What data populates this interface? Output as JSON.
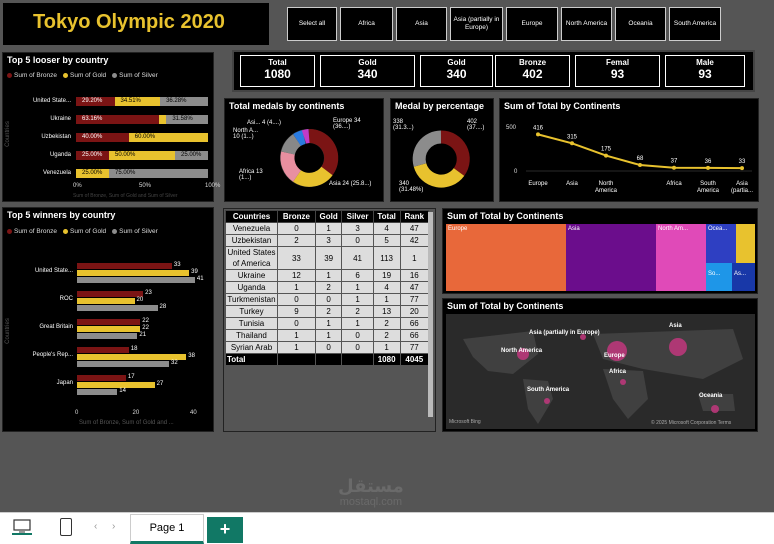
{
  "title": "Tokyo Olympic 2020",
  "slicers": [
    "Select all",
    "Africa",
    "Asia",
    "Asia (partially in Europe)",
    "Europe",
    "North America",
    "Oceania",
    "South America"
  ],
  "kpis": [
    {
      "label": "Total",
      "value": "1080"
    },
    {
      "label": "Gold",
      "value": "340"
    },
    {
      "label": "Gold",
      "value": "340"
    },
    {
      "label": "Bronze",
      "value": "402"
    },
    {
      "label": "Femal",
      "value": "93"
    },
    {
      "label": "Male",
      "value": "93"
    }
  ],
  "colors": {
    "bronze": "#7b1414",
    "gold": "#e8c22e",
    "silver": "#8c8c8c"
  },
  "legend": {
    "bronze": "Sum of Bronze",
    "gold": "Sum of Gold",
    "silver": "Sum of Silver"
  },
  "looser": {
    "title": "Top 5 looser by country",
    "ylabel": "Countries",
    "xlabel": "Sum of Bronze, Sum of Gold and Sum of Silver",
    "ticks": [
      "0%",
      "50%",
      "100%"
    ],
    "rows": [
      {
        "c": "United State...",
        "b": "29.20%",
        "g": "34.51%",
        "s": "36.28%",
        "bv": 29.2,
        "gv": 34.51,
        "sv": 36.28
      },
      {
        "c": "Ukraine",
        "b": "63.16%",
        "g": "",
        "s": "31.58%",
        "bv": 63.16,
        "gv": 5.26,
        "sv": 31.58
      },
      {
        "c": "Uzbekistan",
        "b": "40.00%",
        "g": "60.00%",
        "s": "",
        "bv": 40,
        "gv": 60,
        "sv": 0
      },
      {
        "c": "Uganda",
        "b": "25.00%",
        "g": "50.00%",
        "s": "25.00%",
        "bv": 25,
        "gv": 50,
        "sv": 25
      },
      {
        "c": "Venezuela",
        "b": "",
        "g": "25.00%",
        "s": "75.00%",
        "bv": 0,
        "gv": 25,
        "sv": 75
      }
    ]
  },
  "winners": {
    "title": "Top 5 winners by country",
    "ylabel": "Countries",
    "xlabel": "Sum of Bronze, Sum of Gold and ...",
    "ticks": [
      "0",
      "20",
      "40"
    ],
    "rows": [
      {
        "c": "United State...",
        "b": 33,
        "g": 39,
        "s": 41
      },
      {
        "c": "ROC",
        "b": 23,
        "g": 20,
        "s": 28
      },
      {
        "c": "Great Britain",
        "b": 22,
        "g": 22,
        "s": 21
      },
      {
        "c": "People's Rep...",
        "b": 18,
        "g": 38,
        "s": 32
      },
      {
        "c": "Japan",
        "b": 17,
        "g": 27,
        "s": 14
      }
    ]
  },
  "donut1": {
    "title": "Total medals by continents",
    "labels": [
      "Asi... 4 (4....)",
      "North A... 10 (1...)",
      "Africa 13 (1...)",
      "Asia 24 (25.8...)",
      "Europe 34 (36....)"
    ]
  },
  "donut2": {
    "title": "Medal by percentage",
    "labels": [
      "338 (31.3...)",
      "402 (37....)",
      "340 (31.48%)"
    ]
  },
  "line": {
    "title": "Sum of Total by Continents",
    "ytick": [
      "500",
      "0"
    ],
    "points": [
      {
        "x": "Europe",
        "v": 416
      },
      {
        "x": "Asia",
        "v": 315
      },
      {
        "x": "North America",
        "v": 175
      },
      {
        "x": "Asia (partia...",
        "v": 68
      },
      {
        "x": "Africa",
        "v": 37
      },
      {
        "x": "South America",
        "v": 36
      },
      {
        "x": "Asia (partia...",
        "v": 33
      }
    ],
    "xlabels": [
      "Europe",
      "Asia",
      "North America",
      "",
      "Africa",
      "South America",
      "Asia (partia..."
    ]
  },
  "table": {
    "headers": [
      "Countries",
      "Bronze",
      "Gold",
      "Silver",
      "Total",
      "Rank"
    ],
    "rows": [
      [
        "Venezuela",
        "0",
        "1",
        "3",
        "4",
        "47"
      ],
      [
        "Uzbekistan",
        "2",
        "3",
        "0",
        "5",
        "42"
      ],
      [
        "United States of America",
        "33",
        "39",
        "41",
        "113",
        "1"
      ],
      [
        "Ukraine",
        "12",
        "1",
        "6",
        "19",
        "16"
      ],
      [
        "Uganda",
        "1",
        "2",
        "1",
        "4",
        "47"
      ],
      [
        "Turkmenistan",
        "0",
        "0",
        "1",
        "1",
        "77"
      ],
      [
        "Turkey",
        "9",
        "2",
        "2",
        "13",
        "20"
      ],
      [
        "Tunisia",
        "0",
        "1",
        "1",
        "2",
        "66"
      ],
      [
        "Thailand",
        "1",
        "1",
        "0",
        "2",
        "66"
      ],
      [
        "Syrian Arab",
        "1",
        "0",
        "0",
        "1",
        "77"
      ]
    ],
    "total": [
      "Total",
      "",
      "",
      "",
      "1080",
      "4045"
    ]
  },
  "treemap": {
    "title": "Sum of Total by Continents",
    "cells": [
      "Europe",
      "Asia",
      "North Am...",
      "Ocea...",
      "",
      "So...",
      "As..."
    ]
  },
  "map": {
    "title": "Sum of Total by Continents",
    "labels": [
      "Asia (partially in Europe)",
      "Asia",
      "North America",
      "Europe",
      "Africa",
      "South America",
      "Oceania"
    ],
    "credit": "© 2025 Microsoft Corporation  Terms",
    "brand": "Microsoft Bing"
  },
  "watermark": {
    "arabic": "مستقل",
    "latin": "mostaql.com"
  },
  "footer": {
    "page": "Page 1",
    "add": "+"
  }
}
